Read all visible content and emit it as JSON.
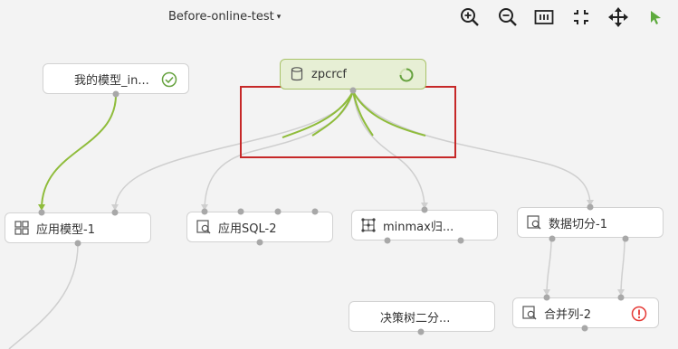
{
  "toolbar": {
    "title": "Before-online-test",
    "caret": "▾",
    "tools": [
      {
        "name": "zoom-in-icon"
      },
      {
        "name": "zoom-out-icon"
      },
      {
        "name": "fit-view-icon"
      },
      {
        "name": "actual-size-icon"
      },
      {
        "name": "move-icon"
      },
      {
        "name": "run-icon"
      }
    ]
  },
  "nodes": {
    "my_model": {
      "label": "我的模型_in...",
      "status": "success"
    },
    "zpcrcf": {
      "label": "zpcrcf",
      "status": "running",
      "icon": "database-icon"
    },
    "apply_model": {
      "label": "应用模型-1",
      "icon": "grid-icon"
    },
    "apply_sql": {
      "label": "应用SQL-2",
      "icon": "sql-icon"
    },
    "minmax": {
      "label": "minmax归...",
      "icon": "matrix-icon"
    },
    "data_split": {
      "label": "数据切分-1",
      "icon": "split-icon"
    },
    "decision_tree": {
      "label": "决策树二分..."
    },
    "merge_cols": {
      "label": "合并列-2",
      "icon": "merge-icon",
      "status": "error"
    }
  },
  "colors": {
    "background": "#f3f3f3",
    "active_edge": "#8fbc3b",
    "inactive_edge": "#cfcfcf",
    "selected_node": "#e7efd5",
    "highlight_box": "#c62828",
    "error": "#e53935",
    "success": "#66a23f",
    "run": "#5daa3d"
  }
}
